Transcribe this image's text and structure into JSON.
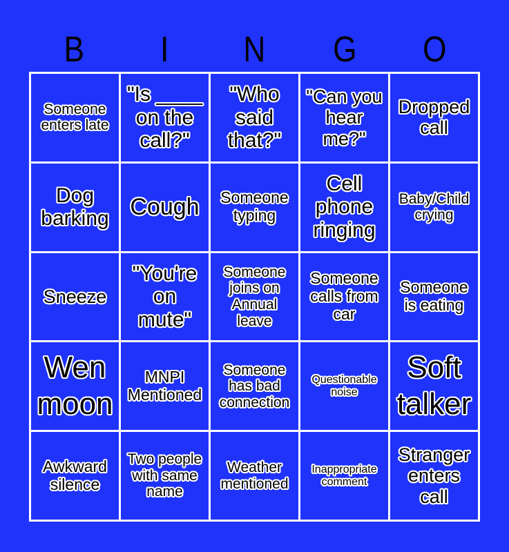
{
  "title_letters": [
    "B",
    "I",
    "N",
    "G",
    "O"
  ],
  "colors": {
    "background": "#1f33fb",
    "grid_lines": "#ffffff",
    "text_fill": "#000000",
    "text_outline": "#ffffff"
  },
  "board": [
    [
      "Someone enters late",
      "\"Is ____ on the call?\"",
      "\"Who said that?\"",
      "\"Can you hear me?\"",
      "Dropped call"
    ],
    [
      "Dog barking",
      "Cough",
      "Someone typing",
      "Cell phone ringing",
      "Baby/Child crying"
    ],
    [
      "Sneeze",
      "\"You're on mute\"",
      "Someone joins on Annual leave",
      "Someone calls from car",
      "Someone is eating"
    ],
    [
      "Wen moon",
      "MNPI Mentioned",
      "Someone has bad connection",
      "Questionable noise",
      "Soft talker"
    ],
    [
      "Awkward silence",
      "Two people with same name",
      "Weather mentioned",
      "Inappropriate comment",
      "Stranger enters call"
    ]
  ]
}
